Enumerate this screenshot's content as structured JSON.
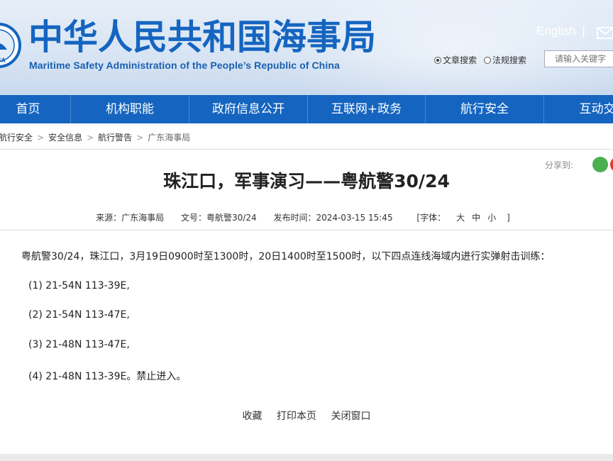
{
  "header": {
    "site_title_cn": "中华人民共和国海事局",
    "site_title_en": "Maritime Safety Administration of the People’s Republic of China",
    "logo_text": "MSA",
    "lang_link": "English",
    "separator": "|",
    "search": {
      "option_article": "文章搜索",
      "option_law": "法规搜索",
      "placeholder": "请输入关键字"
    }
  },
  "nav": {
    "items": [
      "首页",
      "机构职能",
      "政府信息公开",
      "互联网+政务",
      "航行安全",
      "互动交流"
    ]
  },
  "breadcrumb": {
    "items": [
      "航行安全",
      "安全信息",
      "航行警告",
      "广东海事局"
    ],
    "separator": ">"
  },
  "share": {
    "label": "分享到:"
  },
  "article": {
    "title": "珠江口，军事演习——粤航警30/24",
    "meta": {
      "source": "来源：广东海事局",
      "doc_no": "文号：粤航警30/24",
      "publish_time": "发布时间：2024-03-15 15:45",
      "font_label": "[字体：",
      "font_large": "大",
      "font_medium": "中",
      "font_small": "小",
      "font_close": "]"
    },
    "paragraphs": [
      "粤航警30/24，珠江口，3月19日0900时至1300时，20日1400时至1500时，以下四点连线海域内进行实弹射击训练：",
      "(1) 21-54N 113-39E,",
      "(2) 21-54N 113-47E,",
      "(3) 21-48N 113-47E,",
      "(4) 21-48N 113-39E。禁止进入。"
    ]
  },
  "actions": {
    "favorite": "收藏",
    "print": "打印本页",
    "close": "关闭窗口"
  },
  "colors": {
    "brand_blue": "#1565c0",
    "nav_bg": "#1565c0"
  }
}
